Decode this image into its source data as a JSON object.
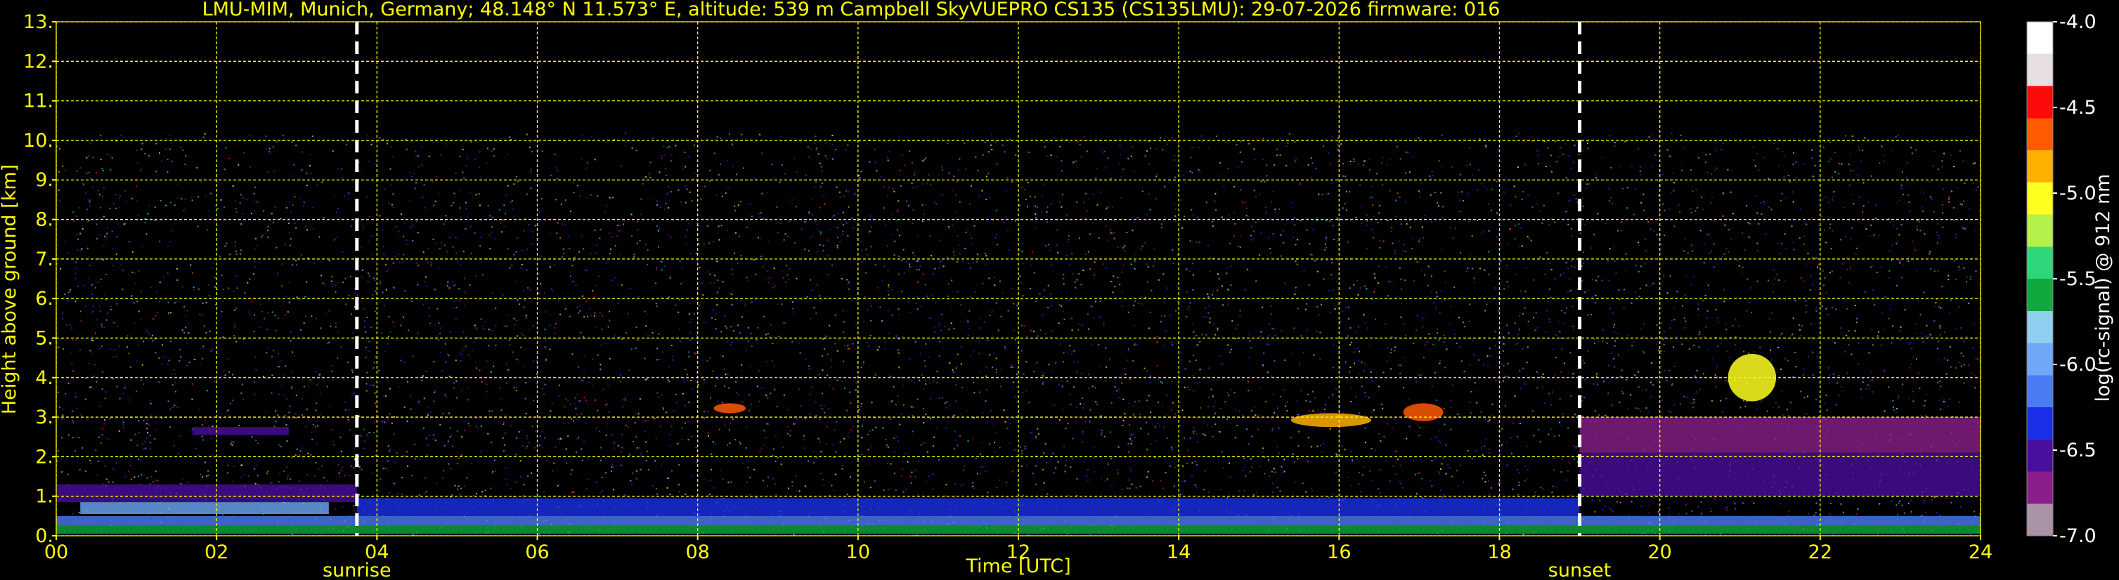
{
  "colors": {
    "background": "#000000",
    "text": "#ffff00",
    "grid": "#ffff00",
    "event_line": "#ffffff",
    "colorbar_text": "#ffffff"
  },
  "chart_data": {
    "type": "heatmap",
    "title": "LMU-MIM, Munich, Germany; 48.148° N 11.573° E, altitude: 539 m    Campbell SkyVUEPRO CS135 (CS135LMU): 29-07-2026    firmware: 016",
    "xlabel": "Time [UTC]",
    "ylabel": "Height above ground [km]",
    "x_range": [
      0,
      24
    ],
    "y_range": [
      0,
      13
    ],
    "x_ticks": [
      0,
      2,
      4,
      6,
      8,
      10,
      12,
      14,
      16,
      18,
      20,
      22,
      24
    ],
    "x_tick_labels": [
      "00",
      "02",
      "04",
      "06",
      "08",
      "10",
      "12",
      "14",
      "16",
      "18",
      "20",
      "22",
      "24"
    ],
    "y_ticks": [
      0,
      1,
      2,
      3,
      4,
      5,
      6,
      7,
      8,
      9,
      10,
      11,
      12,
      13
    ],
    "y_tick_labels": [
      "0.",
      "1.",
      "2.",
      "3.",
      "4.",
      "5.",
      "6.",
      "7.",
      "8.",
      "9.",
      "10.",
      "11.",
      "12.",
      "13."
    ],
    "grid": true,
    "events": [
      {
        "label": "sunrise",
        "x": 3.75
      },
      {
        "label": "sunset",
        "x": 19.0
      }
    ],
    "colorbar": {
      "label": "log(rc-signal) @ 912 nm",
      "range": [
        -7.0,
        -4.0
      ],
      "ticks": [
        -7.0,
        -6.5,
        -6.0,
        -5.5,
        -5.0,
        -4.5,
        -4.0
      ],
      "tick_labels": [
        "-7.0",
        "-6.5",
        "-6.0",
        "-5.5",
        "-5.0",
        "-4.5",
        "-4.0"
      ],
      "stops": [
        "#a893a8",
        "#8a1e8a",
        "#4a0e9c",
        "#1a2fe8",
        "#4a7cf4",
        "#6fa8f6",
        "#8fd0f0",
        "#11a83f",
        "#2ed67a",
        "#b6f04a",
        "#ffff20",
        "#ffb000",
        "#ff5a00",
        "#ff0a0a",
        "#e8e0e0",
        "#ffffff"
      ]
    },
    "data_limit_km": 10.2,
    "layers": [
      {
        "x": [
          0,
          3.75
        ],
        "y": [
          0.85,
          1.3
        ],
        "level": -6.6
      },
      {
        "x": [
          0.3,
          3.4
        ],
        "y": [
          0.55,
          0.85
        ],
        "level": -6.0
      },
      {
        "x": [
          1.7,
          2.9
        ],
        "y": [
          2.55,
          2.75
        ],
        "level": -6.6
      },
      {
        "x": [
          3.75,
          19.0
        ],
        "y": [
          0.5,
          0.95
        ],
        "level": -6.4
      },
      {
        "x": [
          19.0,
          24
        ],
        "y": [
          1.0,
          2.1
        ],
        "level": -6.6
      },
      {
        "x": [
          19.0,
          24
        ],
        "y": [
          2.1,
          3.0
        ],
        "level": -6.7
      },
      {
        "x": [
          0,
          24
        ],
        "y": [
          0.25,
          0.5
        ],
        "level": -6.1
      },
      {
        "x": [
          0,
          24
        ],
        "y": [
          0.05,
          0.25
        ],
        "level": -5.6
      }
    ],
    "cloud_features": [
      {
        "x": [
          20.85,
          21.45
        ],
        "y": [
          3.4,
          4.6
        ],
        "level": -5.0
      },
      {
        "x": [
          8.2,
          8.6
        ],
        "y": [
          3.1,
          3.35
        ],
        "level": -4.6
      },
      {
        "x": [
          16.8,
          17.3
        ],
        "y": [
          2.9,
          3.35
        ],
        "level": -4.6
      },
      {
        "x": [
          15.4,
          16.4
        ],
        "y": [
          2.75,
          3.1
        ],
        "level": -4.8
      }
    ]
  }
}
